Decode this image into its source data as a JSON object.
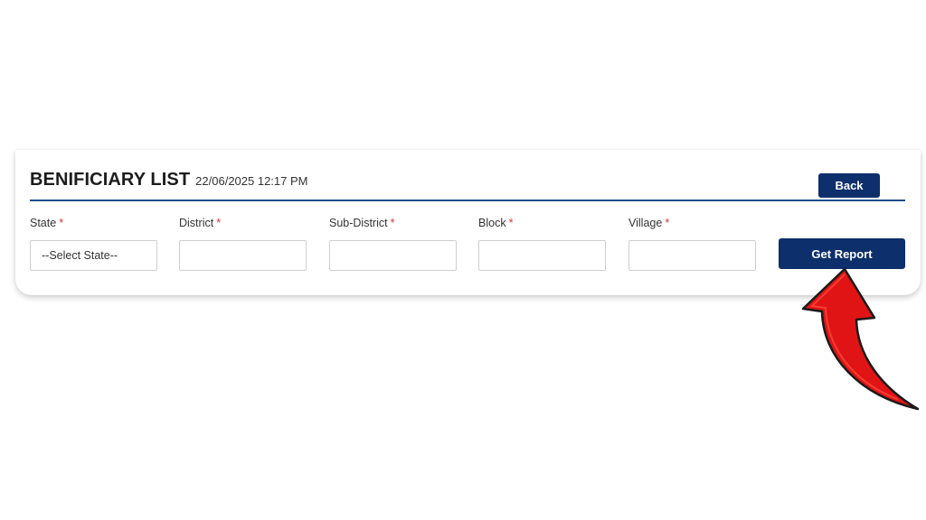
{
  "header": {
    "title": "BENIFICIARY LIST",
    "timestamp": "22/06/2025 12:17 PM",
    "back_label": "Back"
  },
  "filters": [
    {
      "label": "State",
      "required_mark": "*",
      "value": "--Select State--"
    },
    {
      "label": "District",
      "required_mark": "*",
      "value": ""
    },
    {
      "label": "Sub-District",
      "required_mark": "*",
      "value": ""
    },
    {
      "label": "Block",
      "required_mark": "*",
      "value": ""
    },
    {
      "label": "Village",
      "required_mark": "*",
      "value": ""
    }
  ],
  "actions": {
    "get_report_label": "Get Report"
  },
  "annotation": {
    "arrow_icon": "red-curved-arrow-icon",
    "arrow_color": "#e01414"
  },
  "colors": {
    "primary_button": "#0d2f6b",
    "divider": "#1e4e8c",
    "required": "#d9342b"
  }
}
